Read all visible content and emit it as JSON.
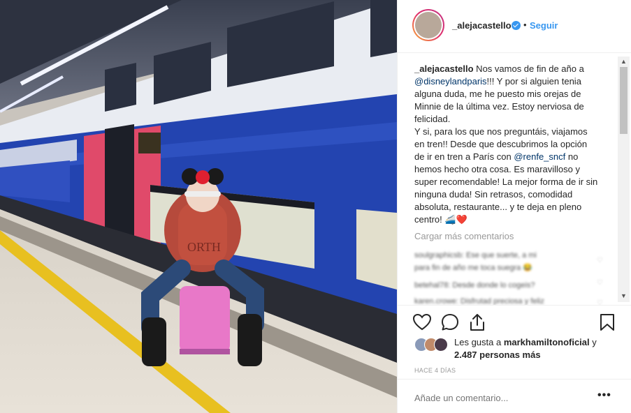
{
  "post": {
    "username": "_alejacastello",
    "follow_label": "Seguir",
    "separator": "•",
    "caption_user": "_alejacastello",
    "caption_part1": " Nos vamos de fin de año a ",
    "mention1": "@disneylandparis",
    "caption_part2": "!!! Y por si alguien tenia alguna duda, me he puesto mis orejas de Minnie de la última vez. Estoy nerviosa de felicidad.\nY si, para los que nos preguntáis, viajamos en tren!! Desde que descubrimos la opción de ir en tren a París con ",
    "mention2": "@renfe_sncf",
    "caption_part3": " no hemos hecho otra cosa. Es maravilloso y super recomendable! La mejor forma de ir sin ninguna duda! Sin retrasos, comodidad absoluta, restaurante... y te deja en pleno centro! 🚄❤️",
    "load_more": "Cargar más comentarios",
    "blurred_comments": [
      "soulgraphicsb: Ese que suerte, a mi",
      "para fin de año me toca suegra 😂",
      "betehal78: Desde donde lo cogeis?",
      "karen.crowe: Disfrutad preciosa y feliz"
    ],
    "likes_prefix": "Les gusta a ",
    "likes_user": "markhamiltonoficial",
    "likes_middle": " y",
    "likes_count": "2.487 personas más",
    "time_ago": "HACE 4 DÍAS",
    "comment_placeholder": "Añade un comentario...",
    "more_options": "•••"
  },
  "icons": {
    "like": "heart-icon",
    "comment": "comment-icon",
    "share": "share-icon",
    "save": "bookmark-icon",
    "verified": "verified-badge-icon"
  },
  "colors": {
    "link": "#3897f0",
    "mention": "#003569",
    "muted": "#999999",
    "text": "#262626"
  }
}
